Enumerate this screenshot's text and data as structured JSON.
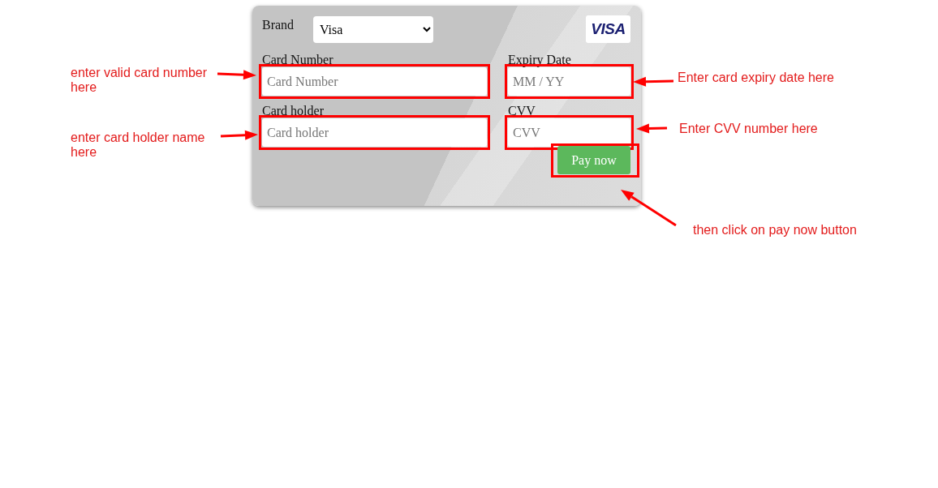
{
  "card": {
    "brand_label": "Brand",
    "brand_value": "Visa",
    "logo": "VISA",
    "fields": [
      {
        "label": "Card Number",
        "placeholder": "Card Number",
        "annotation": "enter valid card number here"
      },
      {
        "label": "Expiry Date",
        "placeholder": "MM / YY",
        "annotation": "Enter card expiry date here"
      },
      {
        "label": "Card holder",
        "placeholder": "Card holder",
        "annotation": "enter card holder name here"
      },
      {
        "label": "CVV",
        "placeholder": "CVV",
        "annotation": "Enter CVV number here"
      }
    ],
    "pay_button": {
      "label": "Pay now",
      "annotation": "then click on pay now button"
    }
  }
}
